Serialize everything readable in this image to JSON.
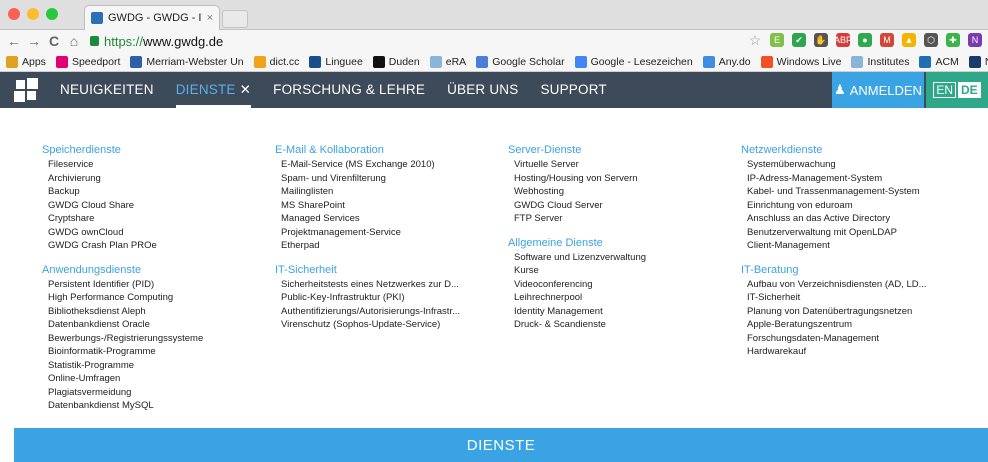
{
  "browser": {
    "tab_title": "GWDG - GWDG - IT in der",
    "tab_close": "×",
    "url_secure": "https://",
    "url_host": "www.gwdg.de",
    "nav": {
      "back": "←",
      "forward": "→",
      "reload": "C",
      "home": "⌂"
    },
    "extensions": [
      {
        "name": "bookmark-star-icon",
        "label": "☆",
        "color": "#999999"
      },
      {
        "name": "evernote-clip-icon",
        "label": "E",
        "color": "#7fbf4a"
      },
      {
        "name": "checkmark-icon",
        "label": "✔",
        "color": "#2ea44f"
      },
      {
        "name": "glove-icon",
        "label": "✋",
        "color": "#555555"
      },
      {
        "name": "adblock-icon",
        "label": "ABP",
        "color": "#d83b3b"
      },
      {
        "name": "pin-icon",
        "label": "●",
        "color": "#2fa84f"
      },
      {
        "name": "gmail-icon",
        "label": "M",
        "color": "#d44638"
      },
      {
        "name": "drive-icon",
        "label": "▲",
        "color": "#f4b400"
      },
      {
        "name": "pocket-icon",
        "label": "⬡",
        "color": "#555555"
      },
      {
        "name": "puzzle-icon",
        "label": "✚",
        "color": "#3bb54a"
      },
      {
        "name": "onenote-icon",
        "label": "N",
        "color": "#7b3ab0"
      }
    ]
  },
  "bookmarks": [
    {
      "label": "Apps",
      "color": "#e0a020",
      "icon": "apps-grid-icon"
    },
    {
      "label": "Speedport",
      "color": "#e20074",
      "icon": "telekom-icon"
    },
    {
      "label": "Merriam-Webster Un",
      "color": "#2f5fa8",
      "icon": "merriam-webster-icon"
    },
    {
      "label": "dict.cc",
      "color": "#f2a11a",
      "icon": "dictcc-icon"
    },
    {
      "label": "Linguee",
      "color": "#1a4d8c",
      "icon": "linguee-icon"
    },
    {
      "label": "Duden",
      "color": "#111111",
      "icon": "duden-icon"
    },
    {
      "label": "eRA",
      "color": "#8ab4d8",
      "icon": "folder-icon"
    },
    {
      "label": "Google Scholar",
      "color": "#4a7ed8",
      "icon": "scholar-icon"
    },
    {
      "label": "Google - Lesezeichen",
      "color": "#4285f4",
      "icon": "google-icon"
    },
    {
      "label": "Any.do",
      "color": "#3f8de0",
      "icon": "anydo-icon"
    },
    {
      "label": "Windows Live",
      "color": "#f25022",
      "icon": "windows-icon"
    },
    {
      "label": "Institutes",
      "color": "#8ab4d8",
      "icon": "folder-icon"
    },
    {
      "label": "ACM",
      "color": "#1f6fb2",
      "icon": "acm-icon"
    },
    {
      "label": "NASA ADS",
      "color": "#1b3b6f",
      "icon": "nasa-ads-icon"
    }
  ],
  "site": {
    "nav": [
      {
        "label": "NEUIGKEITEN",
        "active": false
      },
      {
        "label": "DIENSTE",
        "active": true
      },
      {
        "label": "FORSCHUNG & LEHRE",
        "active": false
      },
      {
        "label": "ÜBER UNS",
        "active": false
      },
      {
        "label": "SUPPORT",
        "active": false
      }
    ],
    "close_symbol": "✕",
    "login_label": "ANMELDEN",
    "lang_en": "EN",
    "lang_de": "DE",
    "footer_label": "DIENSTE"
  },
  "menu": {
    "col1": [
      {
        "title": "Speicherdienste",
        "items": [
          "Fileservice",
          "Archivierung",
          "Backup",
          "GWDG Cloud Share",
          "Cryptshare",
          "GWDG ownCloud",
          "GWDG Crash Plan PROe"
        ]
      },
      {
        "title": "Anwendungsdienste",
        "items": [
          "Persistent Identifier (PID)",
          "High Performance Computing",
          "Bibliotheksdienst Aleph",
          "Datenbankdienst Oracle",
          "Bewerbungs-/Registrierungssysteme",
          "Bioinformatik-Programme",
          "Statistik-Programme",
          "Online-Umfragen",
          "Plagiatsvermeidung",
          "Datenbankdienst MySQL"
        ]
      }
    ],
    "col2": [
      {
        "title": "E-Mail & Kollaboration",
        "items": [
          "E-Mail-Service (MS Exchange 2010)",
          "Spam- und Virenfilterung",
          "Mailinglisten",
          "MS SharePoint",
          "Managed Services",
          "Projektmanagement-Service",
          "Etherpad"
        ]
      },
      {
        "title": "IT-Sicherheit",
        "items": [
          "Sicherheitstests eines Netzwerkes zur D...",
          "Public-Key-Infrastruktur (PKI)",
          "Authentifizierungs/Autorisierungs-Infrastr...",
          "Virenschutz (Sophos-Update-Service)"
        ]
      }
    ],
    "col3": [
      {
        "title": "Server-Dienste",
        "items": [
          "Virtuelle Server",
          "Hosting/Housing von Servern",
          "Webhosting",
          "GWDG Cloud Server",
          "FTP Server"
        ]
      },
      {
        "title": "Allgemeine Dienste",
        "items": [
          "Software und Lizenzverwaltung",
          "Kurse",
          "Videoconferencing",
          "Leihrechnerpool",
          "Identity Management",
          "Druck- & Scandienste"
        ]
      }
    ],
    "col4": [
      {
        "title": "Netzwerkdienste",
        "items": [
          "Systemüberwachung",
          "IP-Adress-Management-System",
          "Kabel- und Trassenmanagement-System",
          "Einrichtung von eduroam",
          "Anschluss an das Active Directory",
          "Benutzerverwaltung mit OpenLDAP",
          "Client-Management"
        ]
      },
      {
        "title": "IT-Beratung",
        "items": [
          "Aufbau von Verzeichnisdiensten (AD, LD...",
          "IT-Sicherheit",
          "Planung von Datenübertragungsnetzen",
          "Apple-Beratungszentrum",
          "Forschungsdaten-Management",
          "Hardwarekauf"
        ]
      }
    ]
  }
}
